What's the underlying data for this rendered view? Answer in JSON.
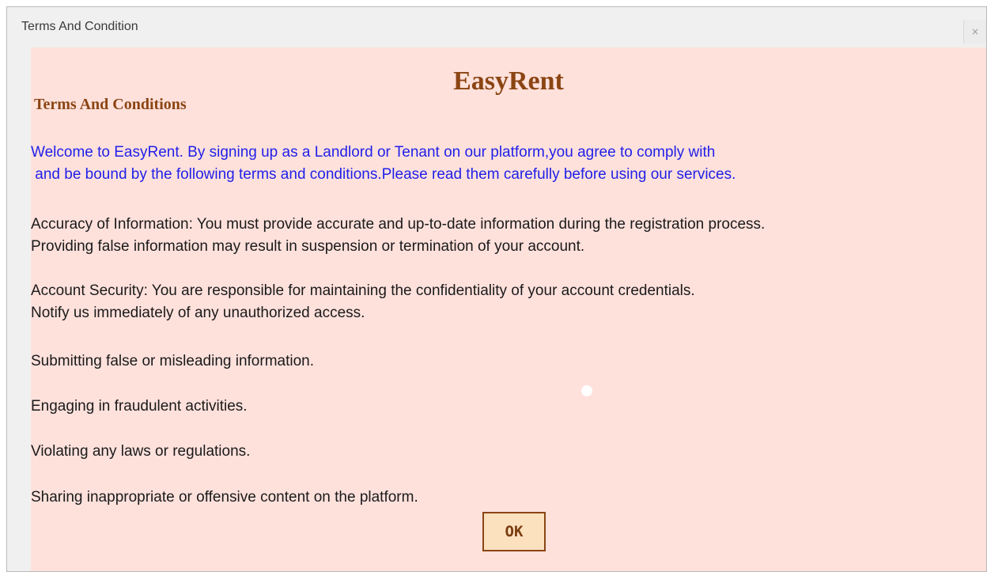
{
  "window": {
    "title": "Terms And Condition",
    "close_symbol": "×"
  },
  "content": {
    "app_name": "EasyRent",
    "section_title": "Terms And Conditions",
    "intro": "Welcome to EasyRent. By signing up as a Landlord or Tenant on our platform,you agree to comply with\n and be bound by the following terms and conditions.Please read them carefully before using our services.",
    "paragraphs": [
      "Accuracy of Information: You must provide accurate and up-to-date information during the registration process.\nProviding false information may result in suspension or termination of your account.",
      "Account Security: You are responsible for maintaining the confidentiality of your account credentials.\nNotify us immediately of any unauthorized access.",
      "Submitting false or misleading information.",
      "Engaging in fraudulent activities.",
      "Violating any laws or regulations.",
      "Sharing inappropriate or offensive content on the platform."
    ],
    "ok_label": "OK"
  },
  "colors": {
    "content_background": "#ffe1dc",
    "brand_brown": "#8b4513",
    "intro_blue": "#1f1fe8",
    "button_fill": "#fce1bf"
  }
}
